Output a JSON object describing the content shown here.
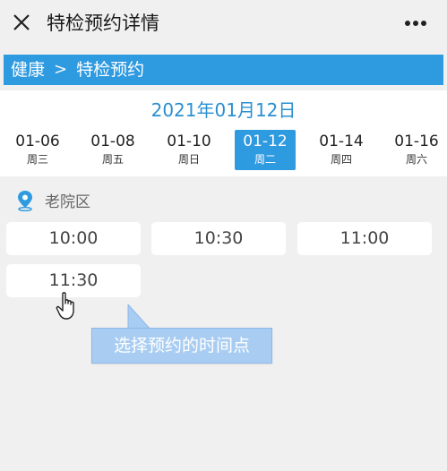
{
  "header": {
    "title": "特检预约详情"
  },
  "breadcrumb": {
    "root": "健康",
    "separator": ">",
    "current": "特检预约"
  },
  "date_title": "2021年01月12日",
  "days": [
    {
      "date": "01-06",
      "weekday": "周三"
    },
    {
      "date": "01-08",
      "weekday": "周五"
    },
    {
      "date": "01-10",
      "weekday": "周日"
    },
    {
      "date": "01-12",
      "weekday": "周二"
    },
    {
      "date": "01-14",
      "weekday": "周四"
    },
    {
      "date": "01-16",
      "weekday": "周六"
    }
  ],
  "selected_day": "01-12",
  "location": {
    "label": "老院区"
  },
  "slots": [
    "10:00",
    "10:30",
    "11:00",
    "11:30"
  ],
  "tooltip": {
    "text": "选择预约的时间点"
  },
  "colors": {
    "accent": "#2e9ae0",
    "tooltip": "#a9cdf2",
    "background": "#f0f0f0"
  }
}
